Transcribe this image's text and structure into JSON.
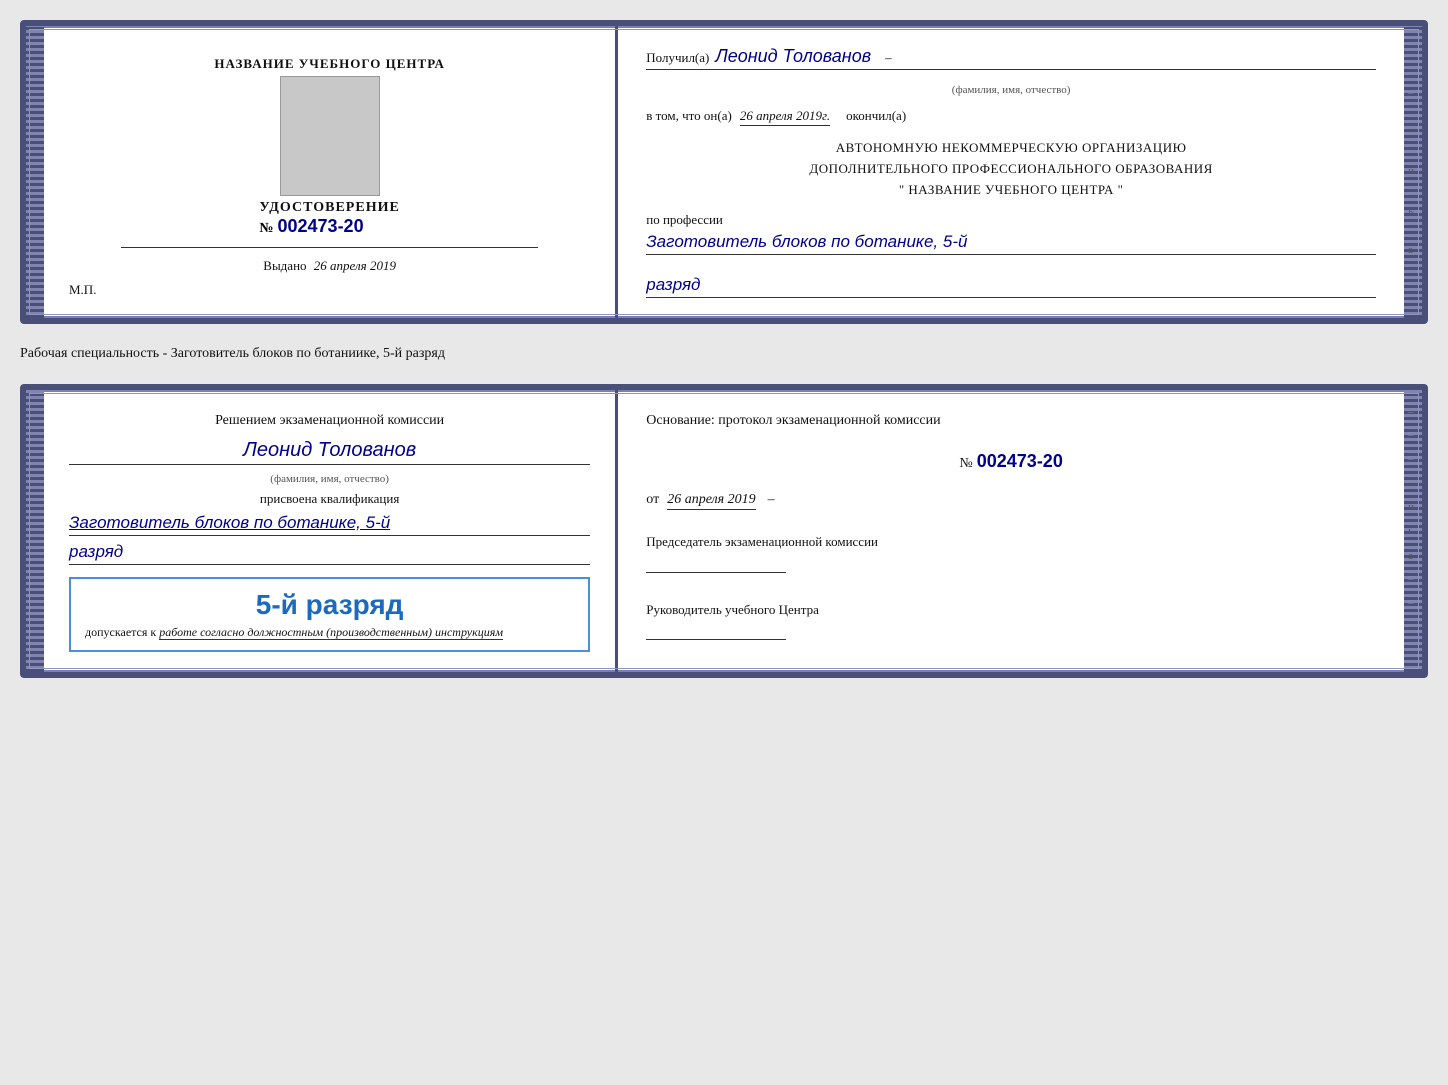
{
  "topCard": {
    "left": {
      "schoolName": "НАЗВАНИЕ УЧЕБНОГО ЦЕНТРА",
      "certTitle": "УДОСТОВЕРЕНИЕ",
      "certNumberPrefix": "№",
      "certNumber": "002473-20",
      "issuedLabel": "Выдано",
      "issuedDate": "26 апреля 2019",
      "mpLabel": "М.П."
    },
    "right": {
      "receivedLabel": "Получил(а)",
      "recipientName": "Леонид Толованов",
      "fieldLabelFIO": "(фамилия, имя, отчество)",
      "dashSymbol": "–",
      "completedPartLabel": "в том, что он(а)",
      "completedDate": "26 апреля 2019г.",
      "completedLabel": "окончил(а)",
      "orgLine1": "АВТОНОМНУЮ НЕКОММЕРЧЕСКУЮ ОРГАНИЗАЦИЮ",
      "orgLine2": "ДОПОЛНИТЕЛЬНОГО ПРОФЕССИОНАЛЬНОГО ОБРАЗОВАНИЯ",
      "orgLine3": "\" НАЗВАНИЕ УЧЕБНОГО ЦЕНТРА \"",
      "professionLabel": "по профессии",
      "professionValue": "Заготовитель блоков по ботанике, 5-й",
      "rankValue": "разряд"
    }
  },
  "separatorLabel": "Рабочая специальность - Заготовитель блоков по ботаниике, 5-й разряд",
  "bottomCard": {
    "left": {
      "decisionText": "Решением экзаменационной комиссии",
      "personName": "Леонид Толованов",
      "fieldLabelFIO": "(фамилия, имя, отчество)",
      "qualificationLabel": "присвоена квалификация",
      "professionValue": "Заготовитель блоков по ботанике, 5-й",
      "rankValue": "разряд",
      "stampRank": "5-й разряд",
      "stampAllowed": "допускается к",
      "stampInstruction": "работе согласно должностным (производственным) инструкциям"
    },
    "right": {
      "basisLabel": "Основание: протокол экзаменационной комиссии",
      "protocolNumberPrefix": "№",
      "protocolNumber": "002473-20",
      "dateFromLabel": "от",
      "dateValue": "26 апреля 2019",
      "chairmanLabel": "Председатель экзаменационной комиссии",
      "directorLabel": "Руководитель учебного Центра"
    }
  },
  "decoChars": {
    "top": [
      "–",
      "–",
      "–",
      "и",
      "ь",
      "а",
      "е",
      "–"
    ],
    "bottom": [
      "–",
      "–",
      "–",
      "–",
      "и",
      "ь",
      "а",
      "е",
      "–",
      "–",
      "–",
      "–"
    ]
  }
}
